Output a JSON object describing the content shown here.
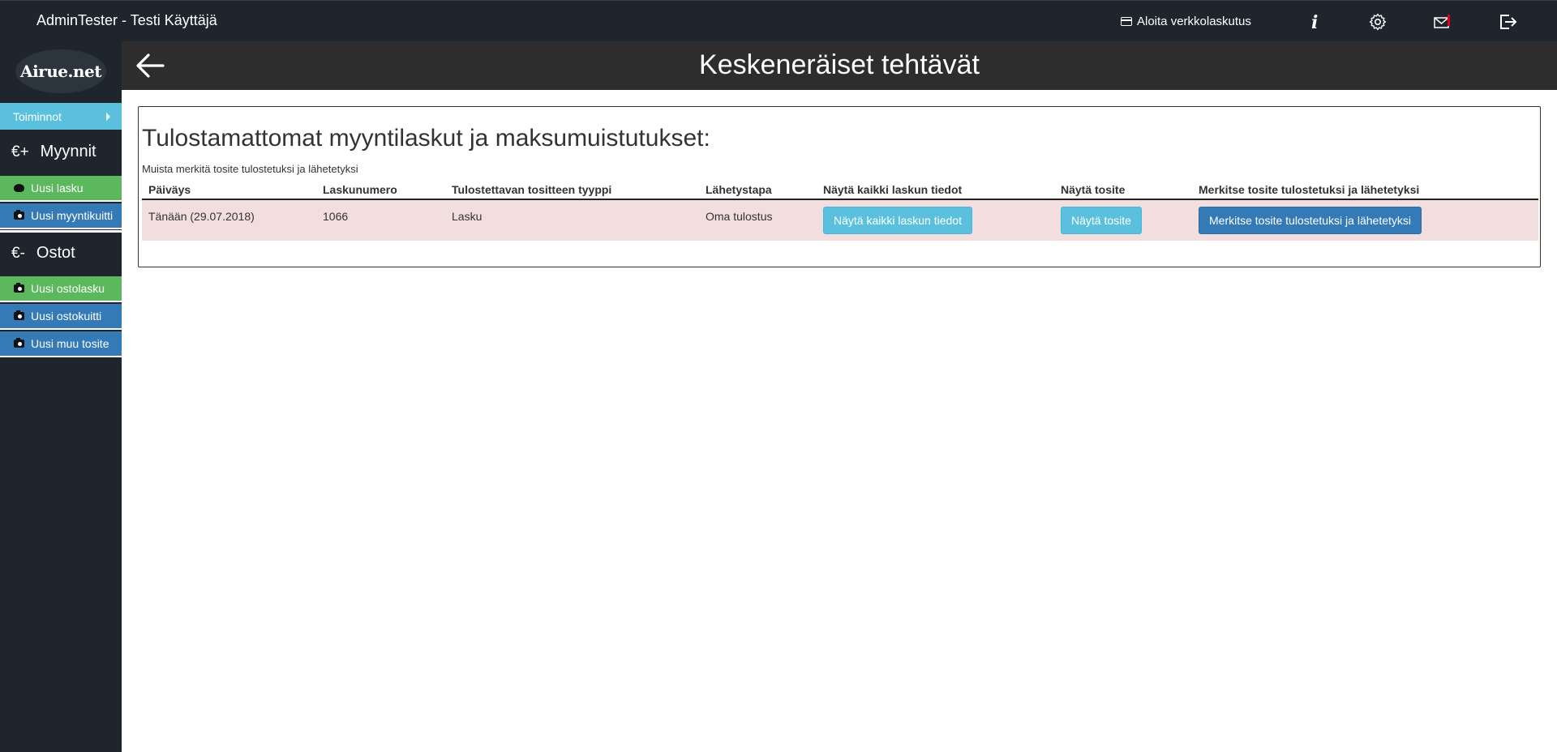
{
  "topbar": {
    "user": "AdminTester - Testi Käyttäjä",
    "einvoice_label": "Aloita verkkolaskutus",
    "icons": [
      "card-icon",
      "info-icon",
      "gear-icon",
      "mail-icon",
      "logout-icon"
    ]
  },
  "sidebar": {
    "logo_text": "Airue.net",
    "menu_toggle": "Toiminnot",
    "sales": {
      "symbol": "€+",
      "title": "Myynnit",
      "items": [
        {
          "label": "Uusi lasku",
          "icon": "piggy-bank-icon",
          "color": "#5cb85c"
        },
        {
          "label": "Uusi myyntikuitti",
          "icon": "camera-icon",
          "color": "#337ab7"
        }
      ]
    },
    "purchases": {
      "symbol": "€-",
      "title": "Ostot",
      "items": [
        {
          "label": "Uusi ostolasku",
          "icon": "camera-icon",
          "color": "#5cb85c"
        },
        {
          "label": "Uusi ostokuitti",
          "icon": "camera-icon",
          "color": "#337ab7"
        },
        {
          "label": "Uusi muu tosite",
          "icon": "camera-icon",
          "color": "#337ab7"
        }
      ]
    }
  },
  "header": {
    "title": "Keskeneräiset tehtävät"
  },
  "panel": {
    "heading": "Tulostamattomat myyntilaskut ja maksumuistutukset:",
    "note": "Muista merkitä tosite tulostetuksi ja lähetetyksi",
    "columns": [
      "Päiväys",
      "Laskunumero",
      "Tulostettavan tositteen tyyppi",
      "Lähetystapa",
      "Näytä kaikki laskun tiedot",
      "Näytä tosite",
      "Merkitse tosite tulostetuksi ja lähetetyksi"
    ],
    "rows": [
      {
        "date": "Tänään (29.07.2018)",
        "number": "1066",
        "type": "Lasku",
        "delivery": "Oma tulostus",
        "show_all_btn": "Näytä kaikki laskun tiedot",
        "show_doc_btn": "Näytä tosite",
        "mark_btn": "Merkitse tosite tulostetuksi ja lähetetyksi"
      }
    ]
  },
  "colors": {
    "topbar": "#1e252d",
    "header": "#2d2d2d",
    "info": "#5bc0de",
    "primary": "#337ab7",
    "success": "#5cb85c",
    "row_danger": "#f2dede"
  }
}
